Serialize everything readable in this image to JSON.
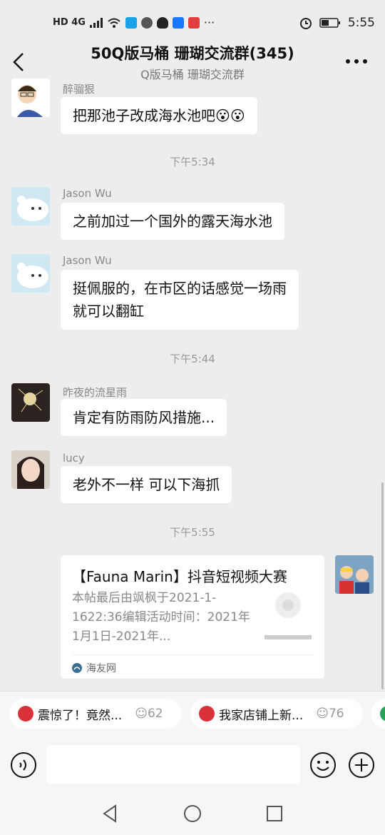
{
  "status_bar": {
    "network": "HD 4G",
    "time": "5:55"
  },
  "header": {
    "title": "50Q版马桶 珊瑚交流群(345)",
    "subtitle": "Q版马桶 珊瑚交流群"
  },
  "messages": [
    {
      "sender": "醉骝狠",
      "text": "把那池子改成海水池吧😮😮"
    },
    {
      "time": "下午5:34"
    },
    {
      "sender": "Jason Wu",
      "text": "之前加过一个国外的露天海水池"
    },
    {
      "sender": "Jason Wu",
      "text_line1": "挺佩服的，在市区的话感觉一场雨",
      "text_line2": "就可以翻缸"
    },
    {
      "time": "下午5:44"
    },
    {
      "sender": "昨夜的流星雨",
      "text": "肯定有防雨防风措施..."
    },
    {
      "sender": "lucy",
      "text": "老外不一样 可以下海抓"
    },
    {
      "time": "下午5:55"
    }
  ],
  "card": {
    "title": "【Fauna Marin】抖音短视频大赛",
    "desc": "本帖最后由飒枫于2021-1-1622:36编辑活动时间：2021年1月1日-2021年...",
    "source": "海友网"
  },
  "suggestions": [
    {
      "label": "震惊了！竟然...",
      "count": "62"
    },
    {
      "label": "我家店铺上新...",
      "count": "76"
    }
  ],
  "colors": {
    "background": "#ededed",
    "bubble": "#ffffff",
    "chip_icon": "#d9303a"
  }
}
